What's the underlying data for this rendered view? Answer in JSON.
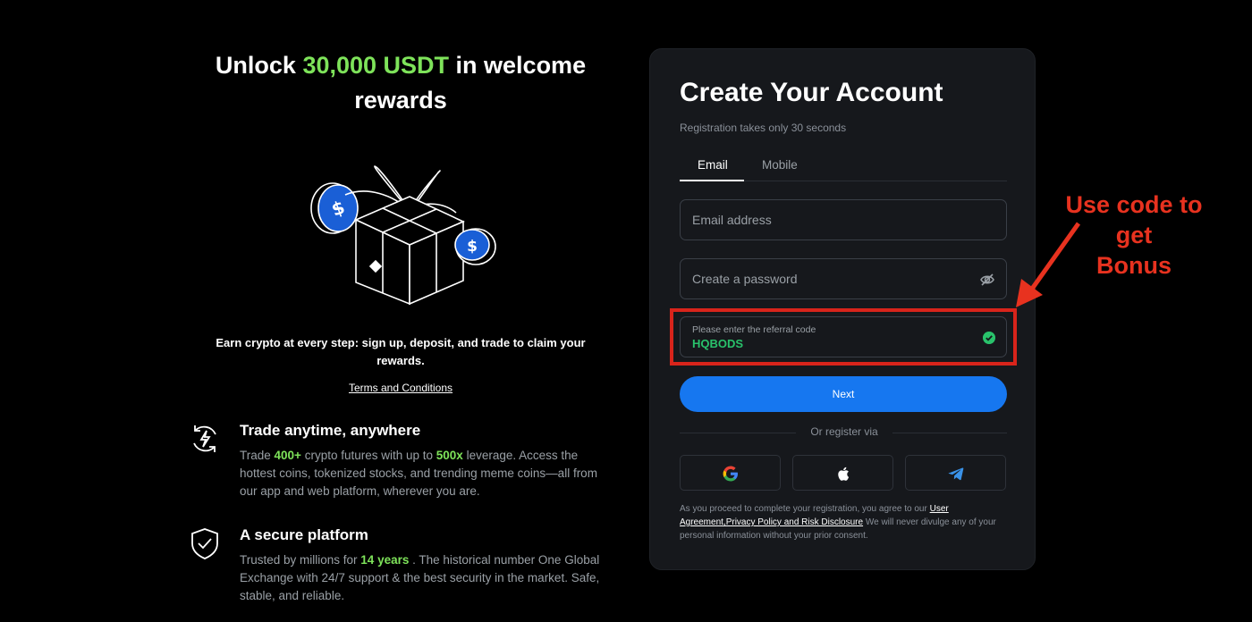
{
  "promo": {
    "headline_pre": "Unlock ",
    "headline_accent": "30,000 USDT",
    "headline_post": " in welcome rewards",
    "earn_text": "Earn crypto at every step: sign up, deposit, and trade to claim your rewards.",
    "terms_link": "Terms and Conditions",
    "features": [
      {
        "title": "Trade anytime, anywhere",
        "body_parts": [
          "Trade ",
          "400+",
          " crypto futures with up to ",
          "500x",
          " leverage. Access the hottest coins, tokenized stocks, and trending meme coins—all from our app and web platform, wherever you are."
        ],
        "icon": "lightning-cycle-icon"
      },
      {
        "title": "A secure platform",
        "body_parts": [
          "Trusted by millions for ",
          "14 years",
          " . The historical number One Global Exchange with 24/7 support & the best security in the market. Safe, stable, and reliable."
        ],
        "icon": "shield-check-icon"
      }
    ]
  },
  "form": {
    "title": "Create Your Account",
    "subtitle": "Registration takes only 30 seconds",
    "tabs": [
      {
        "label": "Email",
        "active": true
      },
      {
        "label": "Mobile",
        "active": false
      }
    ],
    "email_placeholder": "Email address",
    "password_placeholder": "Create a password",
    "referral_label": "Please enter the referral code",
    "referral_value": "HQBODS",
    "next_label": "Next",
    "or_text": "Or register via",
    "social": [
      "google-icon",
      "apple-icon",
      "telegram-icon"
    ],
    "legal_pre": "As you proceed to complete your registration, you agree to our ",
    "legal_link": "User Agreement,Privacy Policy and Risk Disclosure",
    "legal_post": " We will never divulge any of your personal information without your prior consent."
  },
  "annotation": {
    "text_lines": [
      "Use code to",
      "get",
      "Bonus"
    ],
    "color": "#e8321f"
  },
  "colors": {
    "accent_green": "#7ee35a",
    "primary_blue": "#1677f0",
    "success_green": "#29c26b",
    "card_bg": "#16181c"
  }
}
